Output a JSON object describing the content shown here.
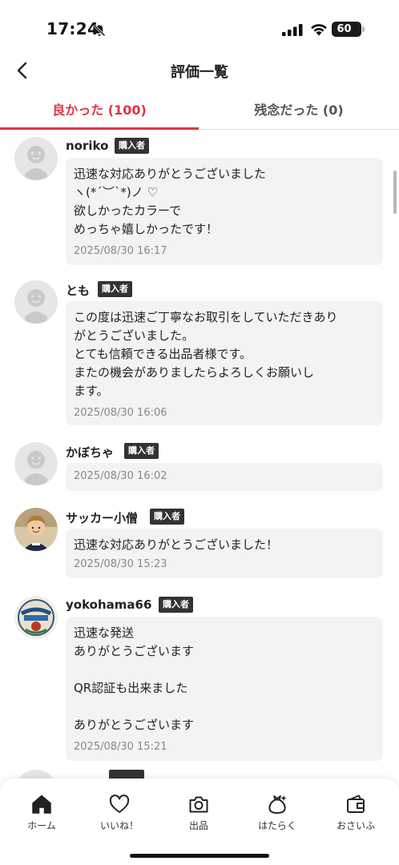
{
  "status_bar": {
    "time": "17:24",
    "battery": "60"
  },
  "nav": {
    "title": "評価一覧"
  },
  "tabs": {
    "good_label": "良かった (100)",
    "bad_label": "残念だった (0)"
  },
  "reviews": [
    {
      "name": "noriko",
      "badge": "購入者",
      "avatar": "default-avatar",
      "lines": [
        "迅速な対応ありがとうございました",
        "ヽ(*´︶`*)ノ ♡",
        "欲しかったカラーで",
        "めっちゃ嬉しかったです！"
      ],
      "date": "2025/08/30 16:17"
    },
    {
      "name": "とも",
      "badge": "購入者",
      "avatar": "default-avatar",
      "lines": [
        "この度は迅速ご丁寧なお取引をしていただきあり",
        "がとうございました。",
        "とても信頼できる出品者様です。",
        "またの機会がありましたらよろしくお願いし",
        "ます。"
      ],
      "date": "2025/08/30 16:06"
    },
    {
      "name": "かぼちゃ",
      "badge": "購入者",
      "avatar": "default-avatar",
      "lines": [],
      "date": "2025/08/30 16:02"
    },
    {
      "name": "サッカー小僧",
      "badge": "購入者",
      "avatar": "photo-avatar",
      "lines": [
        "迅速な対応ありがとうございました！"
      ],
      "date": "2025/08/30 15:23"
    },
    {
      "name": "yokohama66",
      "badge": "購入者",
      "avatar": "logo-avatar",
      "lines": [
        "迅速な発送",
        "ありがとうございます",
        "",
        "QR認証も出来ました",
        "",
        "ありがとうございます"
      ],
      "date": "2025/08/30 15:21"
    }
  ],
  "bottom_nav": [
    {
      "label": "ホーム",
      "icon": "home-icon"
    },
    {
      "label": "いいね！",
      "icon": "heart-icon"
    },
    {
      "label": "出品",
      "icon": "camera-icon"
    },
    {
      "label": "はたらく",
      "icon": "money-bag-icon"
    },
    {
      "label": "おさいふ",
      "icon": "wallet-icon"
    }
  ],
  "colors": {
    "accent": "#e03441",
    "badge_bg": "#333333",
    "bubble_bg": "#f3f3f3"
  }
}
